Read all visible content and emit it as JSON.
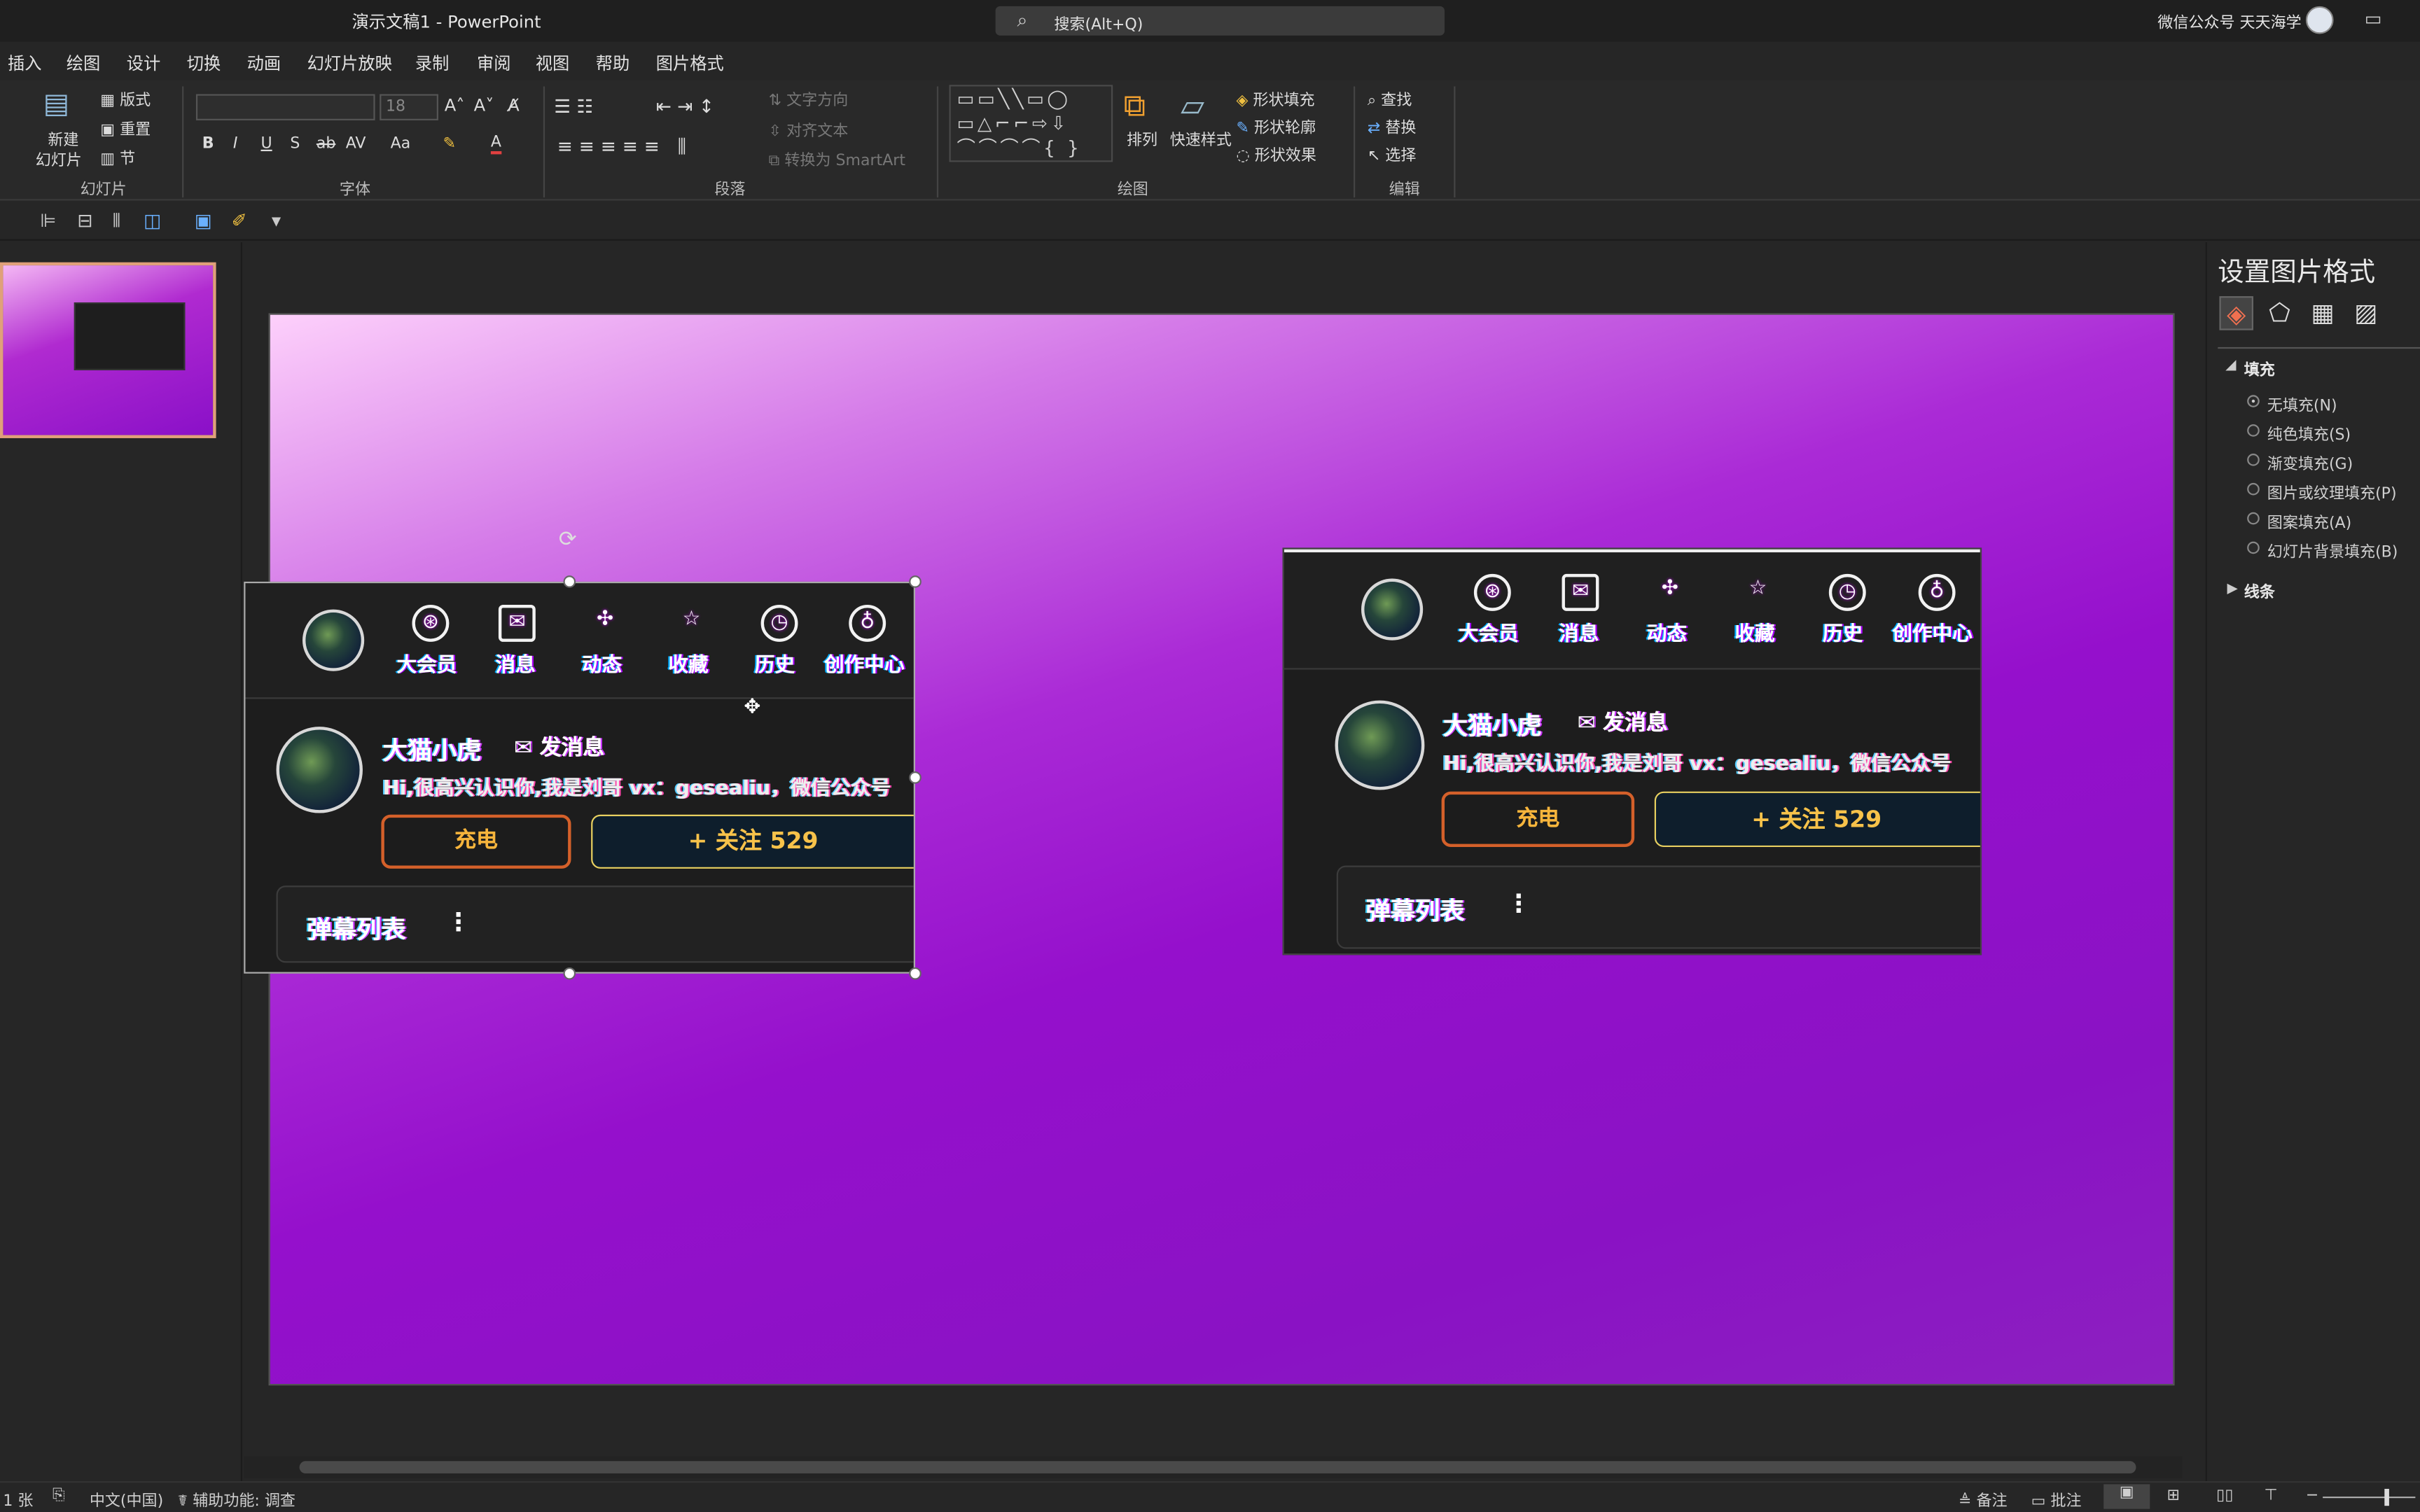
{
  "titlebar": {
    "title": "演示文稿1  -  PowerPoint",
    "search": "搜索(Alt+Q)",
    "user": "微信公众号 天天海学"
  },
  "menu": [
    "插入",
    "绘图",
    "设计",
    "切换",
    "动画",
    "幻灯片放映",
    "录制",
    "审阅",
    "视图",
    "帮助",
    "图片格式"
  ],
  "ribbon": {
    "slides": {
      "new_slide": "新建",
      "new_slide2": "幻灯片",
      "layout": "版式",
      "reset": "重置",
      "section": "节",
      "label": "幻灯片"
    },
    "font": {
      "size": "18",
      "label": "字体",
      "buttons": [
        "B",
        "I",
        "U",
        "S",
        "ab",
        "AV",
        "Aa",
        "A"
      ]
    },
    "paragraph": {
      "text_dir": "文字方向",
      "align_text": "对齐文本",
      "smartart": "转换为 SmartArt",
      "label": "段落"
    },
    "drawing": {
      "arrange": "排列",
      "quick_styles": "快速样式",
      "shape_fill": "形状填充",
      "shape_outline": "形状轮廓",
      "shape_effects": "形状效果",
      "label": "绘图"
    },
    "editing": {
      "find": "查找",
      "replace": "替换",
      "select": "选择",
      "label": "编辑"
    }
  },
  "format_pane": {
    "title": "设置图片格式",
    "section_fill": "填充",
    "options": [
      "无填充(N)",
      "纯色填充(S)",
      "渐变填充(G)",
      "图片或纹理填充(P)",
      "图案填充(A)",
      "幻灯片背景填充(B)"
    ],
    "selected_option": 0,
    "section_line": "线条"
  },
  "card": {
    "nav": [
      {
        "icon": "big-member-icon",
        "glyph": "⊛",
        "label": "大会员"
      },
      {
        "icon": "mail-icon",
        "glyph": "✉",
        "label": "消息"
      },
      {
        "icon": "pinwheel-icon",
        "glyph": "✣",
        "label": "动态"
      },
      {
        "icon": "star-icon",
        "glyph": "☆",
        "label": "收藏"
      },
      {
        "icon": "clock-icon",
        "glyph": "◷",
        "label": "历史"
      },
      {
        "icon": "bulb-icon",
        "glyph": "♁",
        "label": "创作中心"
      }
    ],
    "username": "大猫小虎",
    "send_message": "发消息",
    "bio": "Hi,很高兴认识你,我是刘哥 vx：gesealiu，微信公众号",
    "charge": "充电",
    "follow": "+ 关注 529",
    "list_label": "弹幕列表",
    "kebab": "⋮"
  },
  "statusbar": {
    "slide": "1 张",
    "lang": "中文(中国)",
    "accessibility": "辅助功能: 调查",
    "notes": "备注",
    "comments": "批注"
  }
}
